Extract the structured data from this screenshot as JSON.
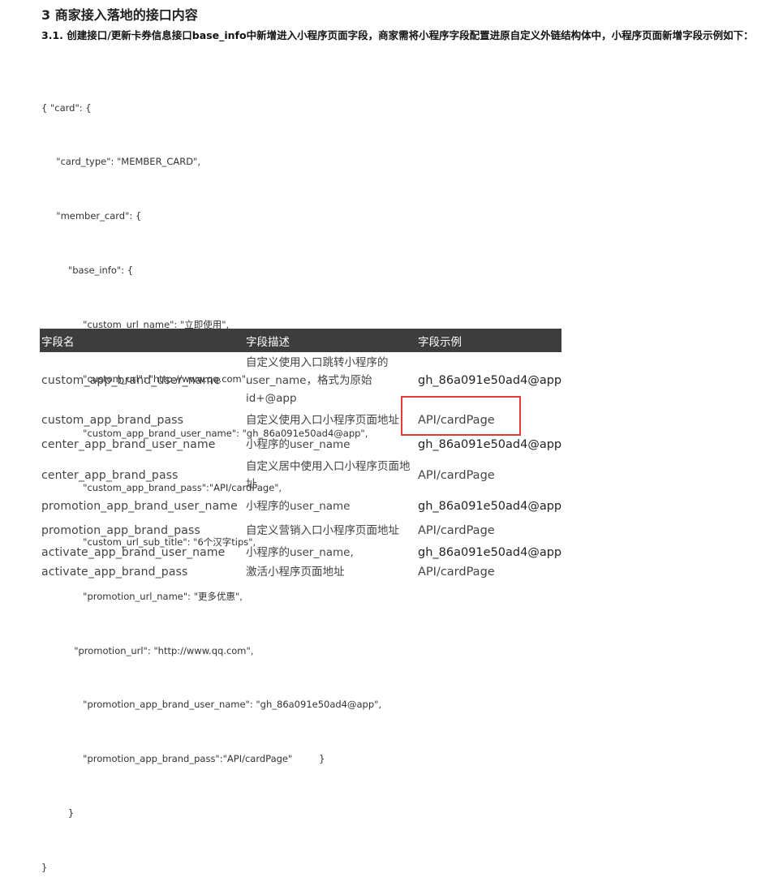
{
  "section": {
    "heading": "3 商家接入落地的接口内容",
    "subheading": "3.1. 创建接口/更新卡券信息接口base_info中新增进入小程序页面字段，商家需将小程序字段配置进原自定义外链结构体中，小程序页面新增字段示例如下："
  },
  "code_lines": [
    "{ \"card\": {",
    "     \"card_type\": \"MEMBER_CARD\",",
    "     \"member_card\": {",
    "         \"base_info\": {",
    "              \"custom_url_name\": \"立即使用\",",
    "              \"custom_url\": \"http://www.qq.com\",",
    "              \"custom_app_brand_user_name\": \"gh_86a091e50ad4@app\",",
    "              \"custom_app_brand_pass\":\"API/cardPage\",",
    "              \"custom_url_sub_title\": \"6个汉字tips\",",
    "              \"promotion_url_name\": \"更多优惠\",",
    "           \"promotion_url\": \"http://www.qq.com\",",
    "              \"promotion_app_brand_user_name\": \"gh_86a091e50ad4@app\",",
    "              \"promotion_app_brand_pass\":\"API/cardPage\"         }",
    "         }",
    "}"
  ],
  "table": {
    "headers": [
      "字段名",
      "字段描述",
      "字段示例"
    ],
    "rows": [
      {
        "name": "custom_app_brand_user_name",
        "desc": "自定义使用入口跳转小程序的user_name，格式为原始id+@app",
        "example": "gh_86a091e50ad4@app"
      },
      {
        "name": "custom_app_brand_pass",
        "desc": "自定义使用入口小程序页面地址",
        "example": "API/cardPage"
      },
      {
        "name": "center_app_brand_user_name",
        "desc": "小程序的user_name",
        "example": "gh_86a091e50ad4@app"
      },
      {
        "name": "center_app_brand_pass",
        "desc": "自定义居中使用入口小程序页面地址",
        "example": "API/cardPage"
      },
      {
        "name": "promotion_app_brand_user_name",
        "desc": "小程序的user_name",
        "example": "gh_86a091e50ad4@app"
      },
      {
        "name": "promotion_app_brand_pass",
        "desc": "自定义营销入口小程序页面地址",
        "example": "API/cardPage"
      },
      {
        "name": "activate_app_brand_user_name",
        "desc": "小程序的user_name,",
        "example": "gh_86a091e50ad4@app"
      },
      {
        "name": "activate_app_brand_pass",
        "desc": "激活小程序页面地址",
        "example": "API/cardPage"
      }
    ]
  },
  "colors": {
    "header_bg": "#3d3d3d",
    "highlight": "#e53935"
  }
}
